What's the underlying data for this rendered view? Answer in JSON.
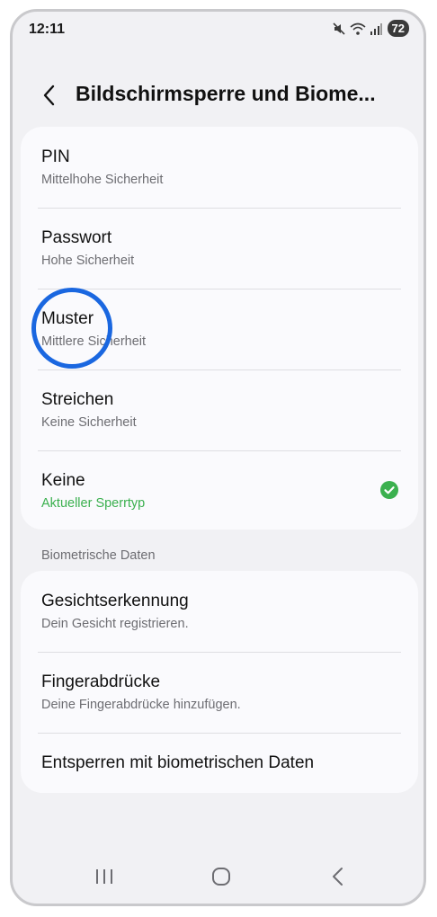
{
  "status_bar": {
    "time": "12:11",
    "battery": "72",
    "icons": [
      "mute-icon",
      "wifi-icon",
      "signal-icon",
      "battery-icon"
    ]
  },
  "header": {
    "title": "Bildschirmsperre und Biome...",
    "back_icon": "chevron-left-icon"
  },
  "lock_types": [
    {
      "title": "PIN",
      "subtitle": "Mittelhohe Sicherheit"
    },
    {
      "title": "Passwort",
      "subtitle": "Hohe Sicherheit"
    },
    {
      "title": "Muster",
      "subtitle": "Mittlere Sicherheit"
    },
    {
      "title": "Streichen",
      "subtitle": "Keine Sicherheit"
    },
    {
      "title": "Keine",
      "subtitle": "Aktueller Sperrtyp",
      "selected": true
    }
  ],
  "biometrics": {
    "section_label": "Biometrische Daten",
    "items": [
      {
        "title": "Gesichtserkennung",
        "subtitle": "Dein Gesicht registrieren."
      },
      {
        "title": "Fingerabdrücke",
        "subtitle": "Deine Fingerabdrücke hinzufügen."
      },
      {
        "title": "Entsperren mit biometrischen Daten"
      }
    ]
  },
  "nav_bar": {
    "buttons": [
      "recent-apps-icon",
      "home-icon",
      "back-icon"
    ]
  },
  "colors": {
    "accent_green": "#3bb04f",
    "highlight_blue": "#1a67e0",
    "background": "#f1f1f4",
    "card": "#fafafd"
  }
}
